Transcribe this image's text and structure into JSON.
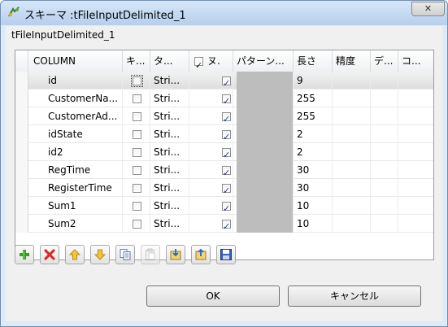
{
  "window": {
    "title": "スキーマ :tFileInputDelimited_1",
    "close_icon": "close-icon",
    "close_symbol": "✕"
  },
  "subtitle": "tFileInputDelimited_1",
  "table": {
    "columns": [
      "COLUMN",
      "キ...",
      "タ...",
      "ヌ.",
      "パターン...",
      "長さ",
      "精度",
      "デ...",
      "コ..."
    ],
    "rows": [
      {
        "column": "id",
        "key": false,
        "type": "Stri...",
        "nullable": true,
        "pattern": "",
        "length": "9",
        "precision": "",
        "default": "",
        "comment": "",
        "selected": true
      },
      {
        "column": "CustomerNa...",
        "key": false,
        "type": "Stri...",
        "nullable": true,
        "pattern": "",
        "length": "255",
        "precision": "",
        "default": "",
        "comment": "",
        "selected": false
      },
      {
        "column": "CustomerAd...",
        "key": false,
        "type": "Stri...",
        "nullable": true,
        "pattern": "",
        "length": "255",
        "precision": "",
        "default": "",
        "comment": "",
        "selected": false
      },
      {
        "column": "idState",
        "key": false,
        "type": "Stri...",
        "nullable": true,
        "pattern": "",
        "length": "2",
        "precision": "",
        "default": "",
        "comment": "",
        "selected": false
      },
      {
        "column": "id2",
        "key": false,
        "type": "Stri...",
        "nullable": true,
        "pattern": "",
        "length": "2",
        "precision": "",
        "default": "",
        "comment": "",
        "selected": false
      },
      {
        "column": "RegTime",
        "key": false,
        "type": "Stri...",
        "nullable": true,
        "pattern": "",
        "length": "30",
        "precision": "",
        "default": "",
        "comment": "",
        "selected": false
      },
      {
        "column": "RegisterTime",
        "key": false,
        "type": "Stri...",
        "nullable": true,
        "pattern": "",
        "length": "30",
        "precision": "",
        "default": "",
        "comment": "",
        "selected": false
      },
      {
        "column": "Sum1",
        "key": false,
        "type": "Stri...",
        "nullable": true,
        "pattern": "",
        "length": "10",
        "precision": "",
        "default": "",
        "comment": "",
        "selected": false
      },
      {
        "column": "Sum2",
        "key": false,
        "type": "Stri...",
        "nullable": true,
        "pattern": "",
        "length": "10",
        "precision": "",
        "default": "",
        "comment": "",
        "selected": false
      }
    ],
    "nullable_header_checked": true
  },
  "toolbar": [
    {
      "name": "add-icon",
      "disabled": false
    },
    {
      "name": "remove-icon",
      "disabled": false
    },
    {
      "name": "move-up-icon",
      "disabled": false
    },
    {
      "name": "move-down-icon",
      "disabled": false
    },
    {
      "name": "copy-icon",
      "disabled": false
    },
    {
      "name": "paste-icon",
      "disabled": true
    },
    {
      "name": "import-icon",
      "disabled": false
    },
    {
      "name": "export-icon",
      "disabled": false
    },
    {
      "name": "save-icon",
      "disabled": false
    }
  ],
  "buttons": {
    "ok": "OK",
    "cancel": "キャンセル"
  },
  "colors": {
    "titlebar": "#c4d9f1",
    "pattern_cell": "#bdbdbd",
    "checkmark": "#1c3b80"
  }
}
